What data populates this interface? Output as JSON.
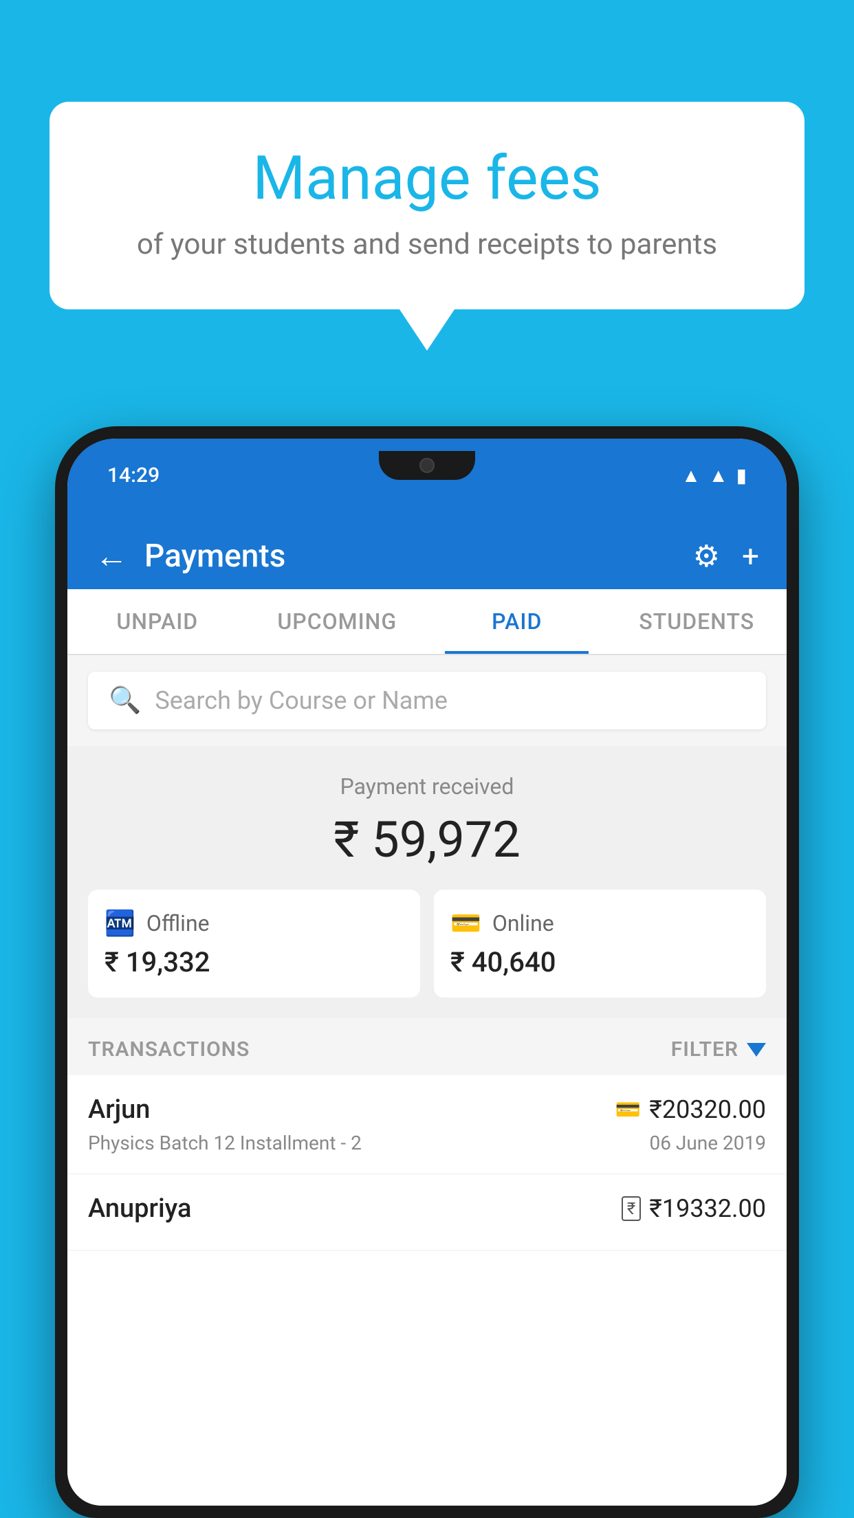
{
  "background_color": "#1ab6e8",
  "hero": {
    "title": "Manage fees",
    "subtitle": "of your students and send receipts to parents"
  },
  "status_bar": {
    "time": "14:29"
  },
  "app_bar": {
    "title": "Payments",
    "back_label": "←"
  },
  "tabs": [
    {
      "label": "UNPAID",
      "active": false
    },
    {
      "label": "UPCOMING",
      "active": false
    },
    {
      "label": "PAID",
      "active": true
    },
    {
      "label": "STUDENTS",
      "active": false
    }
  ],
  "search": {
    "placeholder": "Search by Course or Name"
  },
  "payment_summary": {
    "label": "Payment received",
    "amount": "₹ 59,972",
    "offline": {
      "label": "Offline",
      "amount": "₹ 19,332"
    },
    "online": {
      "label": "Online",
      "amount": "₹ 40,640"
    }
  },
  "transactions": {
    "header": "TRANSACTIONS",
    "filter_label": "FILTER",
    "items": [
      {
        "name": "Arjun",
        "payment_type": "card",
        "amount": "₹20320.00",
        "description": "Physics Batch 12 Installment - 2",
        "date": "06 June 2019"
      },
      {
        "name": "Anupriya",
        "payment_type": "cash",
        "amount": "₹19332.00",
        "description": "",
        "date": ""
      }
    ]
  }
}
